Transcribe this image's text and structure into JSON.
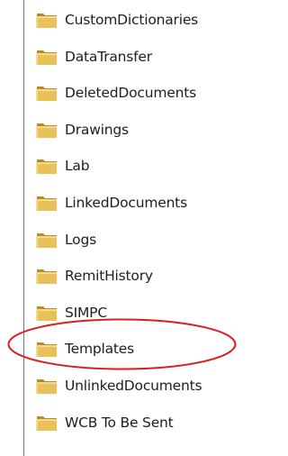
{
  "folders": [
    {
      "label": "CustomDictionaries",
      "icon": "folder-icon"
    },
    {
      "label": "DataTransfer",
      "icon": "folder-icon"
    },
    {
      "label": "DeletedDocuments",
      "icon": "folder-icon"
    },
    {
      "label": "Drawings",
      "icon": "folder-icon"
    },
    {
      "label": "Lab",
      "icon": "folder-icon"
    },
    {
      "label": "LinkedDocuments",
      "icon": "folder-icon"
    },
    {
      "label": "Logs",
      "icon": "folder-icon"
    },
    {
      "label": "RemitHistory",
      "icon": "folder-icon"
    },
    {
      "label": "SIMPC",
      "icon": "folder-icon"
    },
    {
      "label": "Templates",
      "icon": "folder-icon"
    },
    {
      "label": "UnlinkedDocuments",
      "icon": "folder-icon"
    },
    {
      "label": "WCB To Be Sent",
      "icon": "folder-icon"
    }
  ],
  "highlighted_item": "Templates",
  "colors": {
    "highlight_ring": "#d81e1e",
    "folder_fill": "#e9c15a",
    "folder_dark": "#b88b22",
    "text": "#1e1e1e"
  }
}
